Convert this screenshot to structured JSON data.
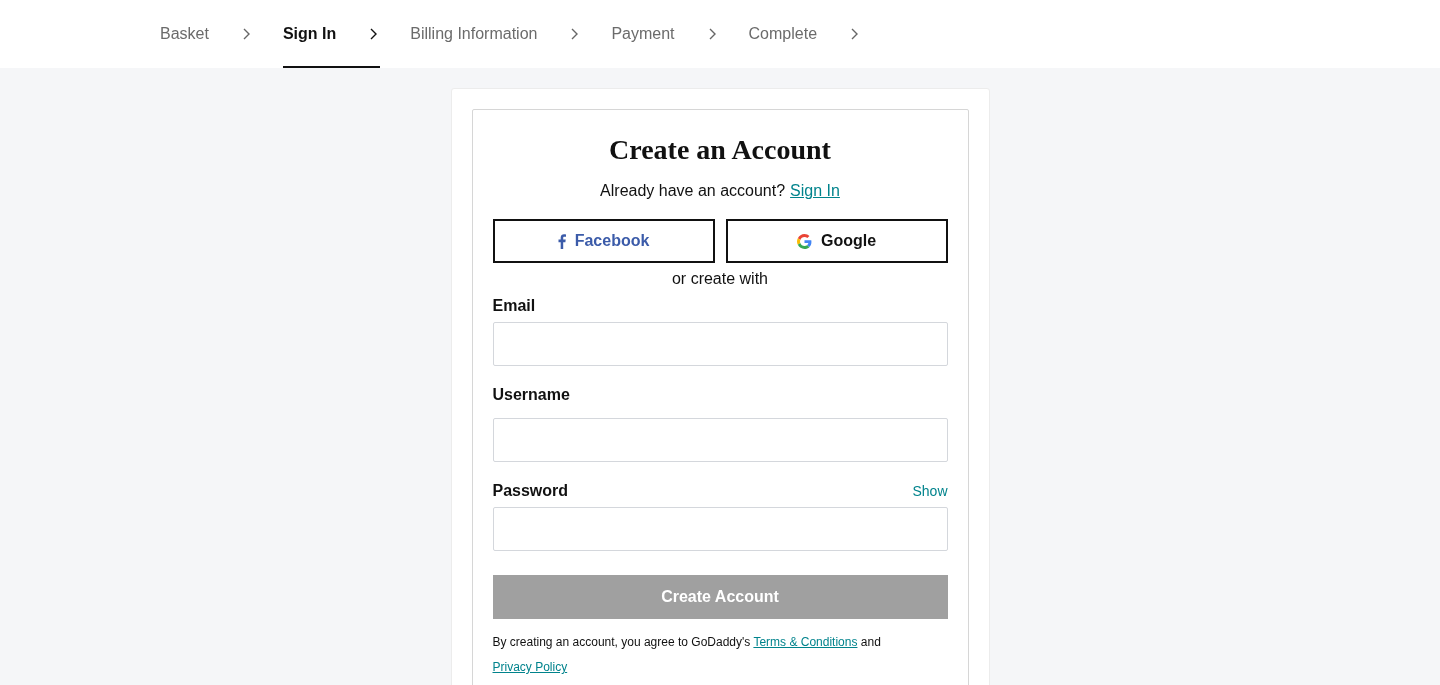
{
  "steps": [
    {
      "label": "Basket",
      "selected": false
    },
    {
      "label": "Sign In",
      "selected": true
    },
    {
      "label": "Billing Information",
      "selected": false
    },
    {
      "label": "Payment",
      "selected": false
    },
    {
      "label": "Complete",
      "selected": false
    }
  ],
  "form": {
    "title": "Create an Account",
    "signin_prompt": "Already have an account?",
    "signin_link": "Sign In",
    "social": [
      {
        "kind": "facebook",
        "label": "Facebook"
      },
      {
        "kind": "google",
        "label": "Google"
      }
    ],
    "divider": "or create with",
    "fields": [
      {
        "label": "Email"
      },
      {
        "label": "Username"
      },
      {
        "label": "Password",
        "action": "Show"
      }
    ],
    "submit": {
      "label": "Create Account",
      "disabled": true
    },
    "legal": {
      "text": "By creating an account, you agree to GoDaddy's",
      "link1": "Terms & Conditions",
      "conj": "and",
      "link2": "Privacy Policy"
    }
  }
}
